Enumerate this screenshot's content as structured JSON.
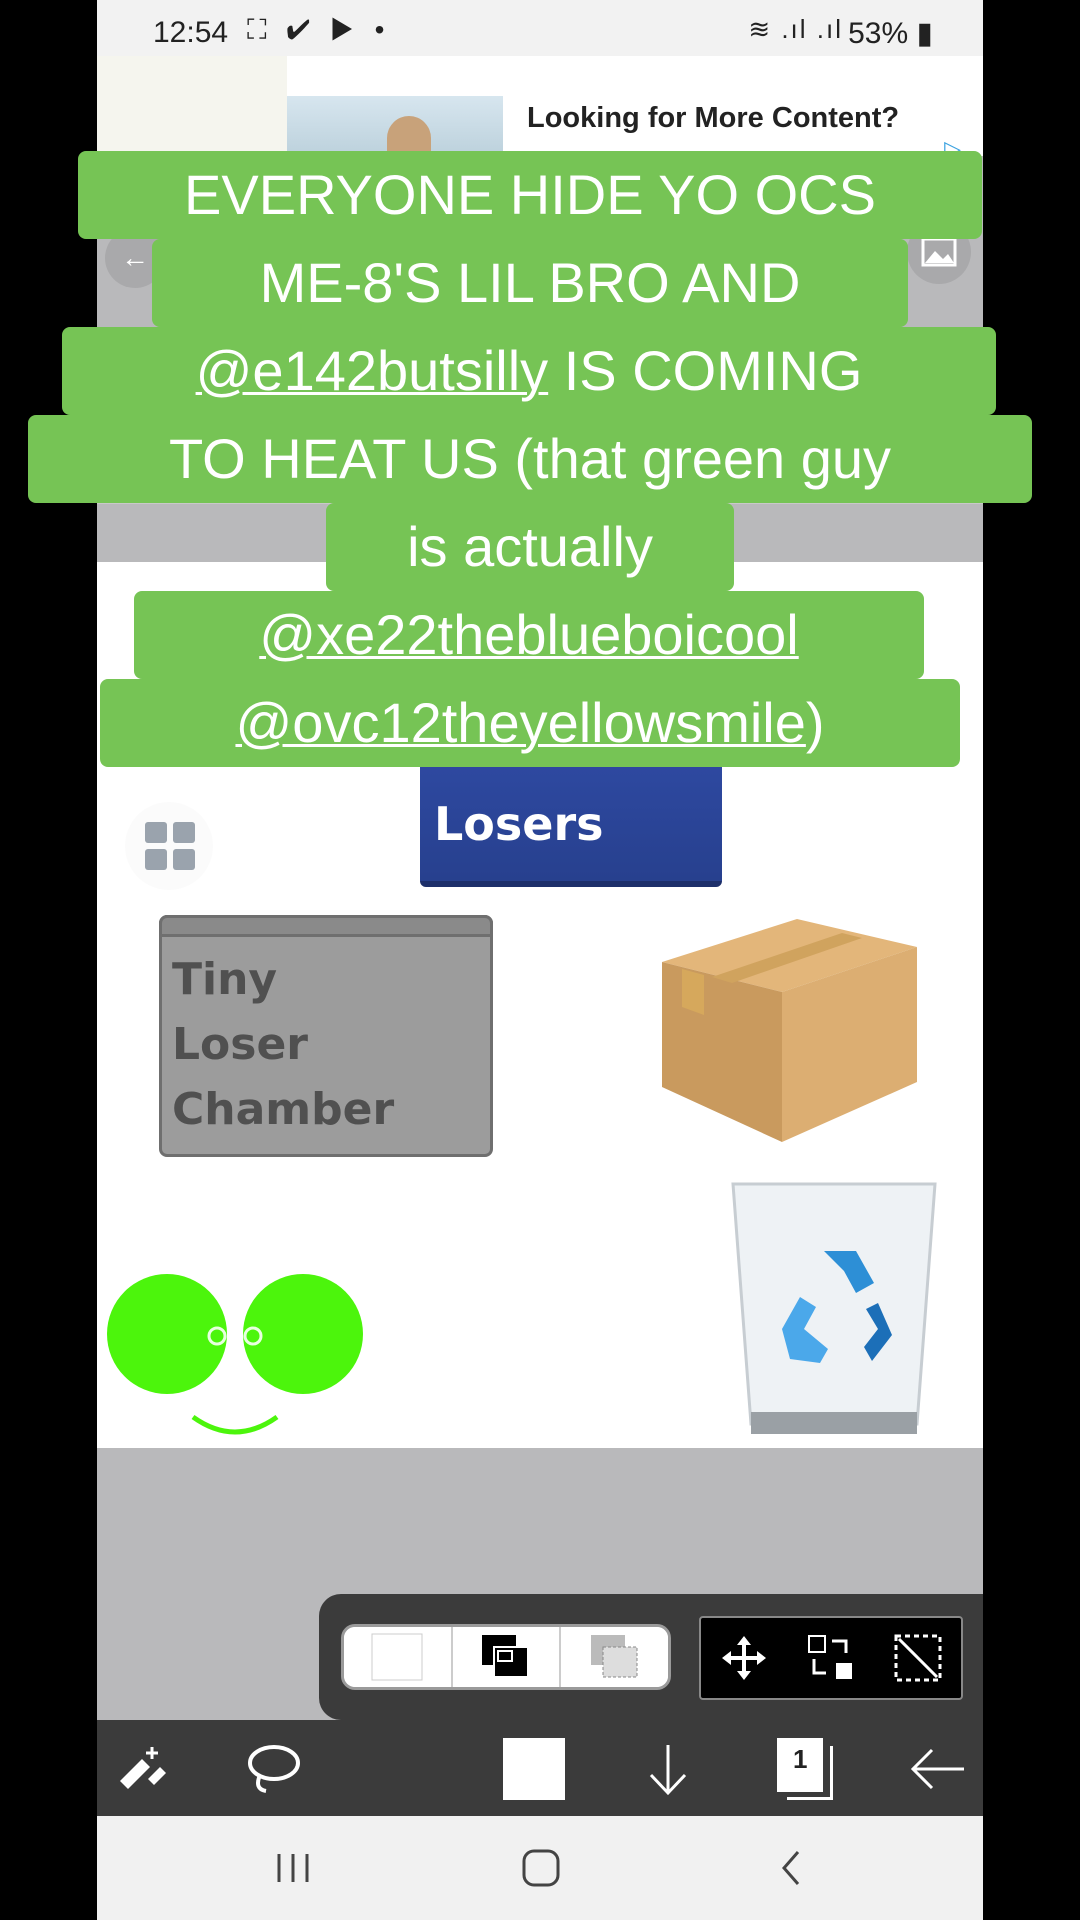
{
  "status_bar": {
    "time": "12:54",
    "left_icons": "⛶ ✔ ▶ •",
    "right_icons": "≋ .ıl .ıl",
    "battery": "53%"
  },
  "ad": {
    "title": "Looking for More Content?"
  },
  "canvas": {
    "sign_text": "Losers",
    "chamber_lines": [
      "Tiny",
      "Loser",
      "Chamber"
    ]
  },
  "caption": {
    "lines": [
      "EVERYONE HIDE YO OCS",
      "ME-8'S LIL BRO AND",
      "@e142butsilly",
      " IS COMING",
      "TO HEAT US (that green guy",
      "is actually",
      "@xe22theblueboicool",
      "@ovc12theyellowsmile",
      ")"
    ]
  },
  "toolbar": {
    "layer_count": "1"
  },
  "colors": {
    "caption_bg": "#76c455",
    "creature_green": "#4cf50c",
    "sign_blue": "#2f4aa3",
    "toolbar_dark": "#3b3b3b"
  },
  "icons": [
    "pen-eraser-icon",
    "lasso-icon",
    "color-swatch-icon",
    "move-down-icon",
    "layers-icon",
    "back-arrow-icon",
    "move-icon",
    "transform-icon",
    "deselect-icon",
    "grid-icon",
    "image-icon"
  ]
}
